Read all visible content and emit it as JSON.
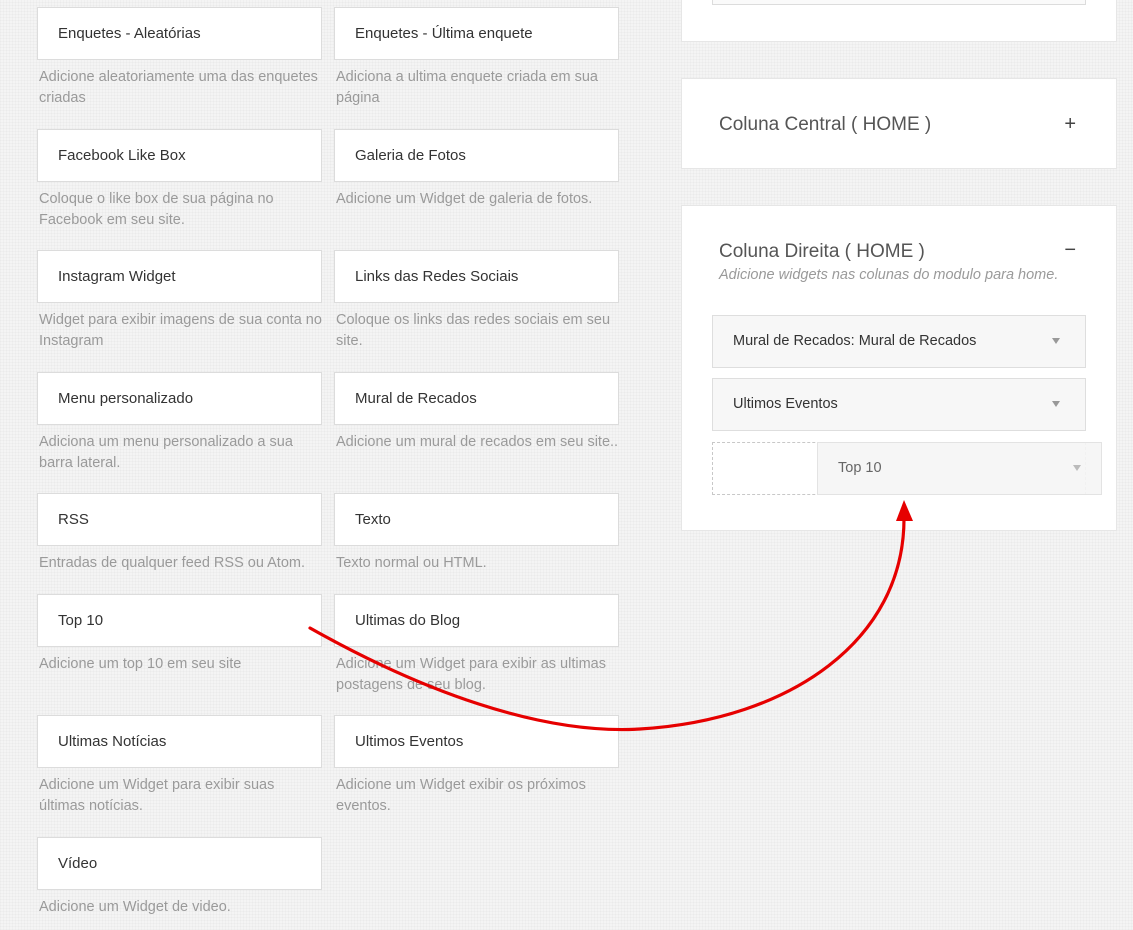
{
  "widgets": [
    {
      "title": "Enquetes - Aleatórias",
      "desc": "Adicione aleatoriamente uma das enquetes criadas"
    },
    {
      "title": "Enquetes - Última enquete",
      "desc": "Adiciona a ultima enquete criada em sua página"
    },
    {
      "title": "Facebook Like Box",
      "desc": "Coloque o like box de sua página no Facebook em seu site."
    },
    {
      "title": "Galeria de Fotos",
      "desc": "Adicione um Widget de galeria de fotos."
    },
    {
      "title": "Instagram Widget",
      "desc": "Widget para exibir imagens de sua conta no Instagram"
    },
    {
      "title": "Links das Redes Sociais",
      "desc": "Coloque os links das redes sociais em seu site."
    },
    {
      "title": "Menu personalizado",
      "desc": "Adiciona um menu personalizado a sua barra lateral."
    },
    {
      "title": "Mural de Recados",
      "desc": "Adicione um mural de recados em seu site.."
    },
    {
      "title": "RSS",
      "desc": "Entradas de qualquer feed RSS ou Atom."
    },
    {
      "title": "Texto",
      "desc": "Texto normal ou HTML."
    },
    {
      "title": "Top 10",
      "desc": "Adicione um top 10 em seu site"
    },
    {
      "title": "Ultimas do Blog",
      "desc": "Adicione um Widget para exibir as ultimas postagens de seu blog."
    },
    {
      "title": "Ultimas Notícias",
      "desc": "Adicione um Widget para exibir suas últimas notícias."
    },
    {
      "title": "Ultimos Eventos",
      "desc": "Adicione um Widget exibir os próximos eventos."
    },
    {
      "title": "Vídeo",
      "desc": "Adicione um Widget de video."
    }
  ],
  "sidebars": {
    "central": {
      "title": "Coluna Central ( HOME )",
      "toggle": "+"
    },
    "direita": {
      "title": "Coluna Direita ( HOME )",
      "toggle": "−",
      "subtitle": "Adicione widgets nas colunas do modulo para home.",
      "items": [
        {
          "label": "Mural de Recados: Mural de Recados"
        },
        {
          "label": "Ultimos Eventos"
        }
      ],
      "dragging": {
        "label": "Top 10"
      }
    }
  },
  "annotation": {
    "arrow_color": "#e60000",
    "arrow_icon": "curved-arrow-icon"
  }
}
